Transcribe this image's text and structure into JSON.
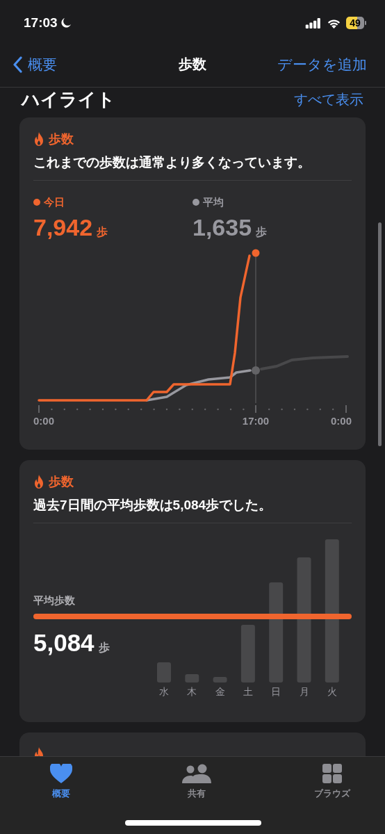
{
  "status_bar": {
    "time": "17:03",
    "battery": "49"
  },
  "nav": {
    "back": "概要",
    "title": "歩数",
    "action": "データを追加"
  },
  "section": {
    "title": "ハイライト",
    "link": "すべて表示"
  },
  "cards": [
    {
      "kind": "today_vs_average",
      "category": "歩数",
      "message": "これまでの歩数は通常より多くなっています。",
      "legend": [
        {
          "label": "今日",
          "value": "7,942",
          "unit": "歩",
          "color": "#f0652e"
        },
        {
          "label": "平均",
          "value": "1,635",
          "unit": "歩",
          "color": "#98989f"
        }
      ],
      "x_labels": [
        "0:00",
        "17:00",
        "0:00"
      ]
    },
    {
      "kind": "weekly_average",
      "category": "歩数",
      "message": "過去7日間の平均歩数は5,084歩でした。",
      "average_label": "平均歩数",
      "average": "5,084",
      "unit": "歩",
      "days": [
        "水",
        "木",
        "金",
        "土",
        "日",
        "月",
        "火"
      ]
    },
    {
      "kind": "partial"
    }
  ],
  "tab_bar": [
    {
      "label": "概要",
      "selected": true
    },
    {
      "label": "共有",
      "selected": false
    },
    {
      "label": "ブラウズ",
      "selected": false
    }
  ]
}
